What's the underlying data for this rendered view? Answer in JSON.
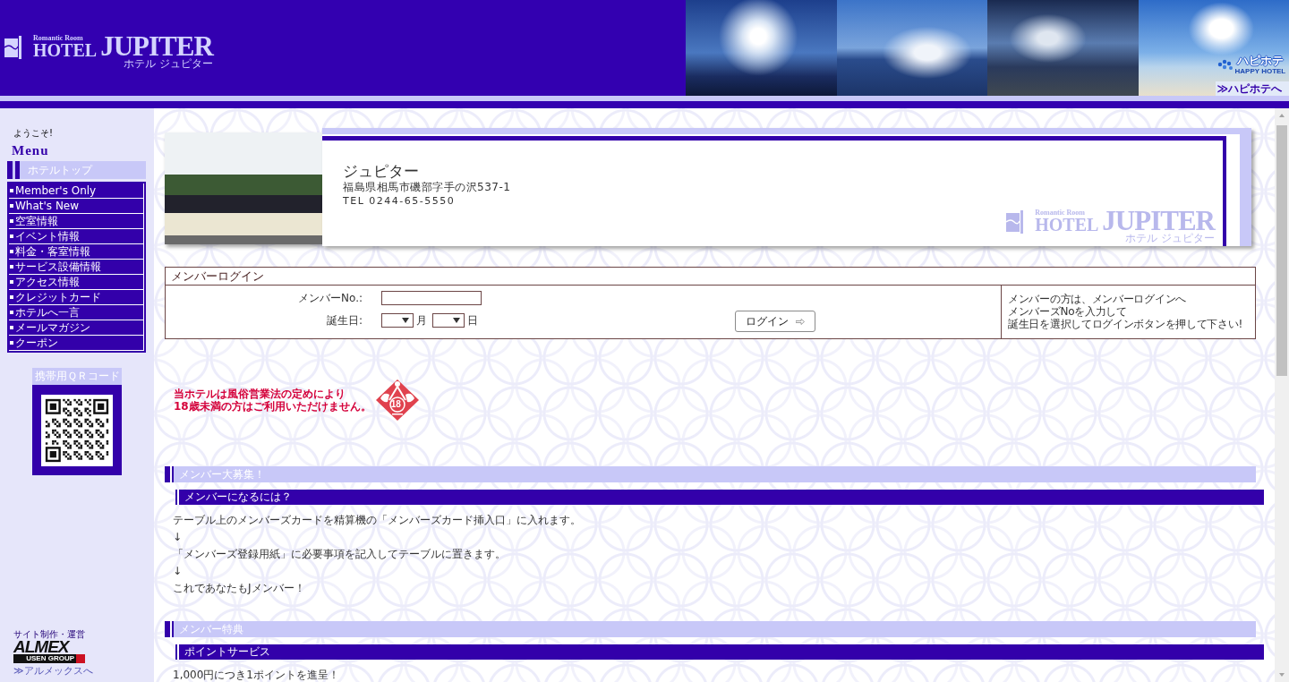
{
  "header": {
    "logo": {
      "tagline": "Romantic Room",
      "hotel": "HOTEL",
      "name": "JUPITER",
      "kana": "ホテル ジュピター"
    },
    "partner": {
      "logo": "ハピホテ",
      "logo_sub": "HAPPY HOTEL",
      "link": "≫ハピホテへ"
    }
  },
  "sidebar": {
    "greeting": "ようこそ!",
    "menu_title": "Menu",
    "top_link": "ホテルトップ",
    "items": [
      "Member's Only",
      "What's New",
      "空室情報",
      "イベント情報",
      "料金・客室情報",
      "サービス設備情報",
      "アクセス情報",
      "クレジットカード",
      "ホテルへ一言",
      "メールマガジン",
      "クーポン"
    ],
    "qr_title": "携帯用ＱＲコード",
    "credit": "サイト制作・運営",
    "company_logo": "ALMEX",
    "company_group": "USEN GROUP",
    "company_link": "≫アルメックスへ"
  },
  "hotel_card": {
    "name": "ジュピター",
    "address": "福島県相馬市磯部字手の沢537-1",
    "tel": "TEL 0244-65-5550",
    "logo": {
      "tagline": "Romantic Room",
      "hotel": "HOTEL",
      "name": "JUPITER",
      "kana": "ホテル ジュピター"
    }
  },
  "login": {
    "title": "メンバーログイン",
    "member_no_label": "メンバーNo.:",
    "birthday_label": "誕生日:",
    "month_unit": "月",
    "day_unit": "日",
    "button": "ログイン",
    "help": [
      "メンバーの方は、メンバーログインへ",
      "メンバーズNoを入力して",
      "誕生日を選択してログインボタンを押して下さい!"
    ]
  },
  "notice": {
    "lines": [
      "当ホテルは風俗営業法の定めにより",
      "18歳未満の方はご利用いただけません。"
    ],
    "badge": "18"
  },
  "sections": [
    {
      "title": "メンバー大募集！",
      "subsections": [
        {
          "title": "メンバーになるには？",
          "lines": [
            "テーブル上のメンバーズカードを精算機の「メンバーズカード挿入口」に入れます。",
            "↓",
            "「メンバーズ登録用紙」に必要事項を記入してテーブルに置きます。",
            "↓",
            "これであなたもJメンバー！"
          ]
        }
      ]
    },
    {
      "title": "メンバー特典",
      "subsections": [
        {
          "title": "ポイントサービス",
          "lines": [
            "1,000円につき1ポイントを進呈！"
          ]
        }
      ]
    }
  ]
}
